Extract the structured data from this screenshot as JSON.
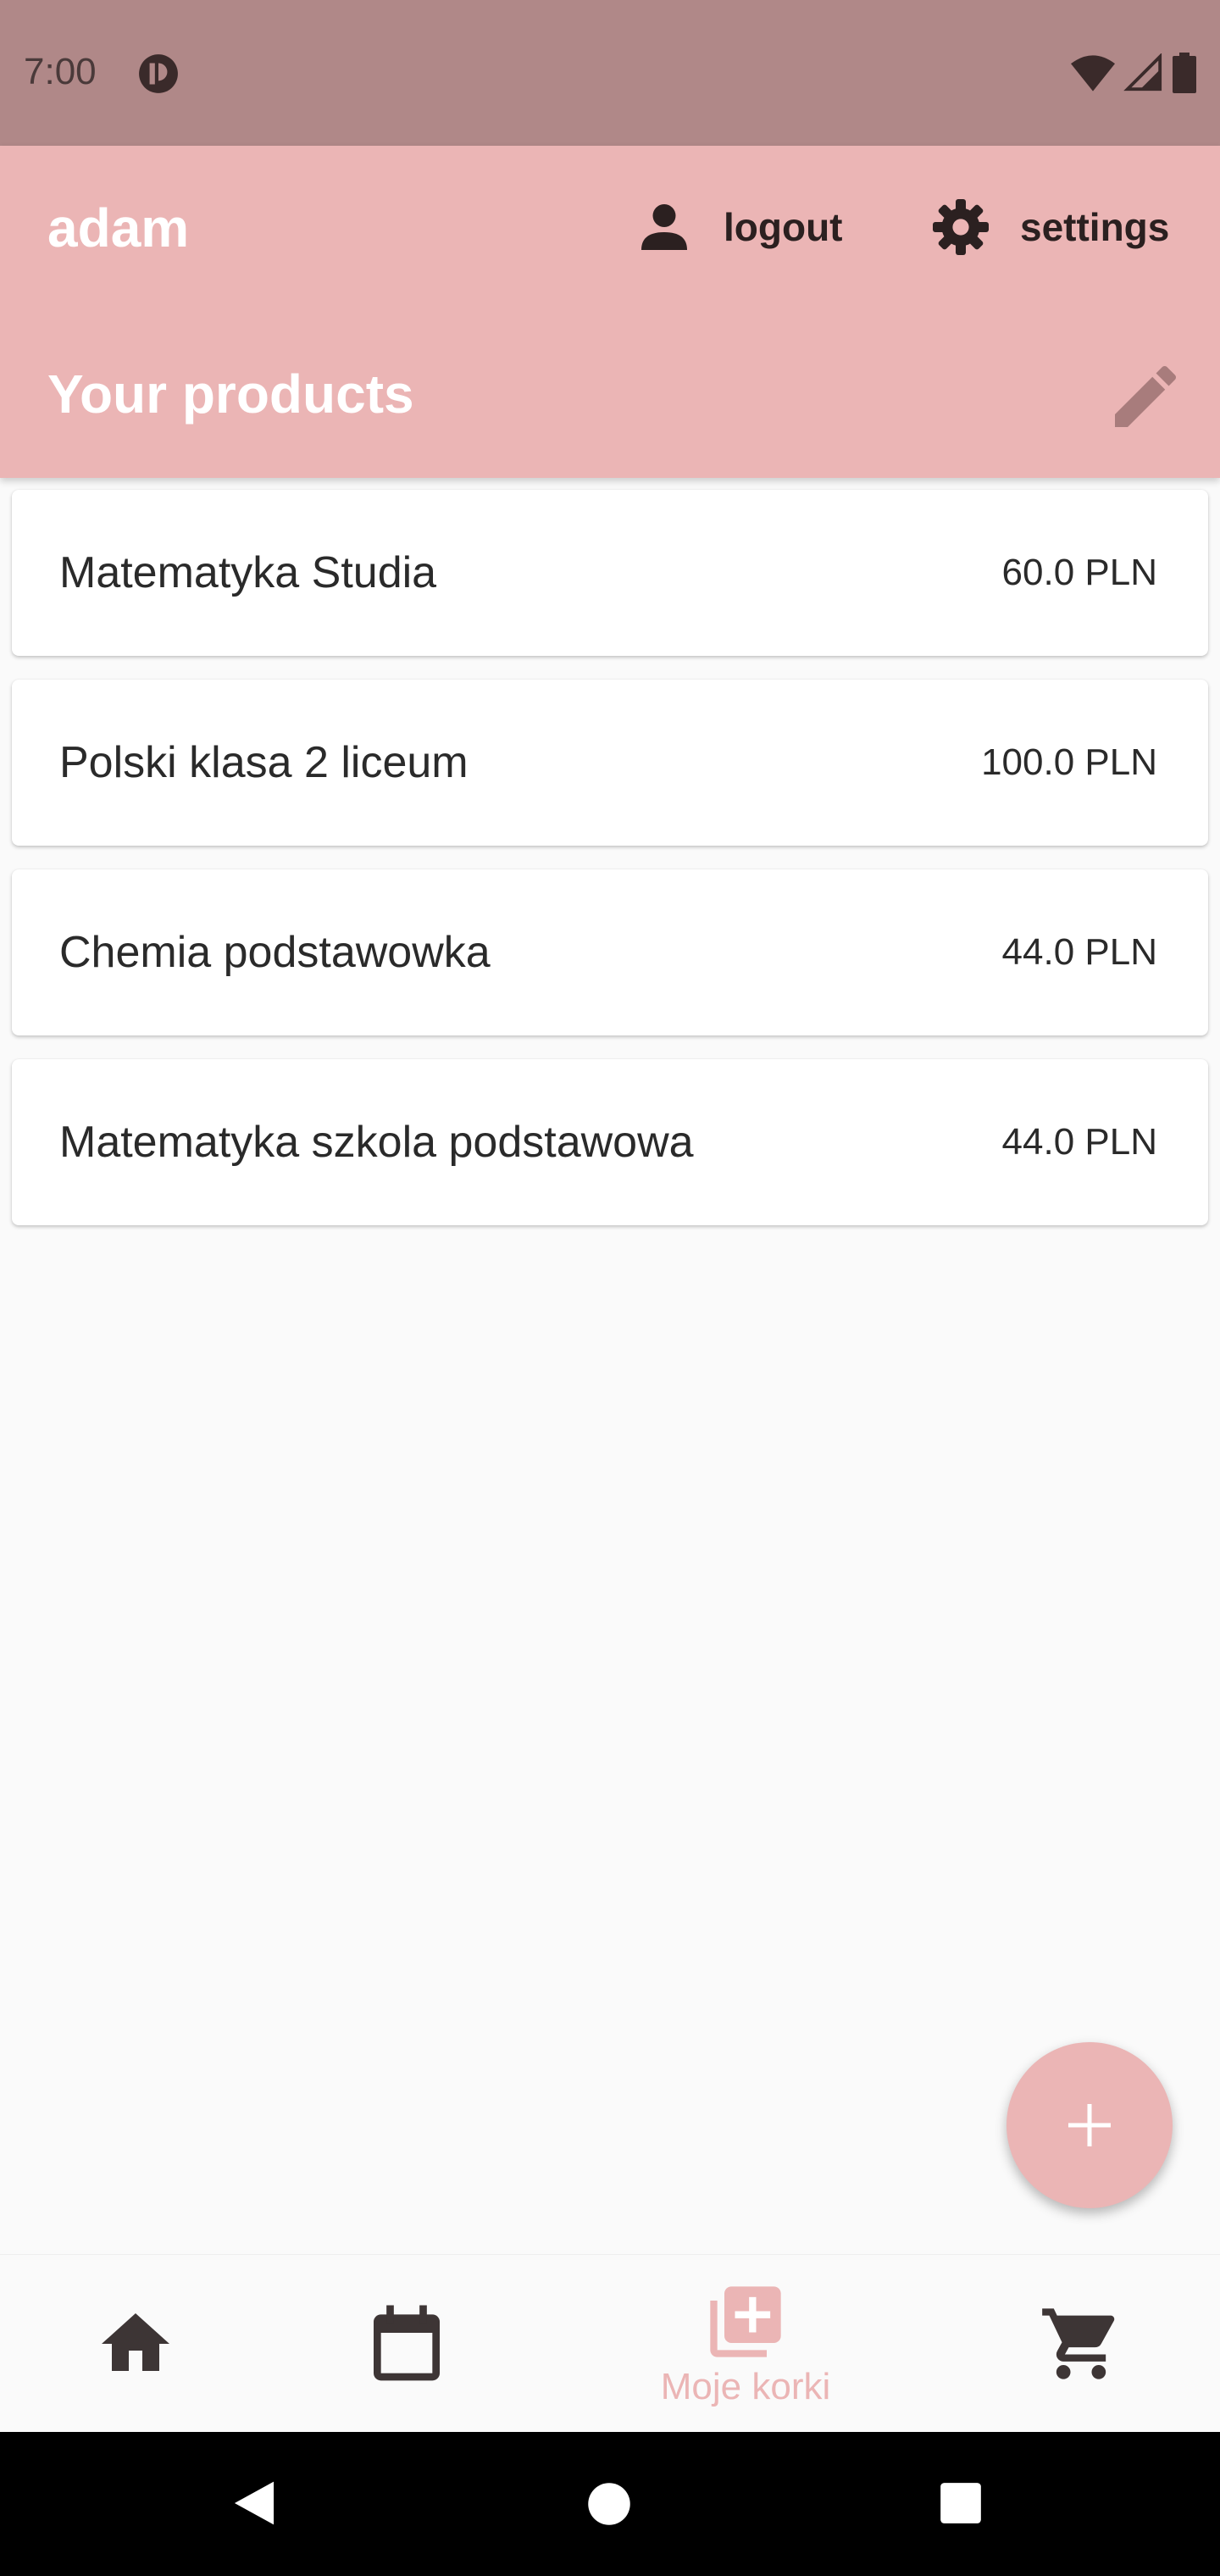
{
  "status_bar": {
    "time": "7:00",
    "icons": [
      "app-notification-icon",
      "wifi-icon",
      "signal-icon",
      "battery-icon"
    ]
  },
  "header": {
    "username": "adam",
    "logout_label": "logout",
    "settings_label": "settings",
    "title": "Your products",
    "icons": [
      "person-icon",
      "gear-icon",
      "edit-pencil-icon"
    ]
  },
  "products": [
    {
      "name": "Matematyka Studia",
      "price": "60.0 PLN"
    },
    {
      "name": "Polski klasa 2 liceum",
      "price": "100.0 PLN"
    },
    {
      "name": "Chemia podstawowka",
      "price": "44.0 PLN"
    },
    {
      "name": "Matematyka szkola podstawowa",
      "price": "44.0 PLN"
    }
  ],
  "fab": {
    "icon": "plus-icon"
  },
  "bottom_nav": {
    "items": [
      {
        "icon": "home-icon",
        "label": ""
      },
      {
        "icon": "calendar-icon",
        "label": ""
      },
      {
        "icon": "add-library-icon",
        "label": "Moje korki",
        "active": true
      },
      {
        "icon": "shopping-cart-icon",
        "label": ""
      }
    ]
  },
  "system_nav": {
    "icons": [
      "back-icon",
      "home-circle-icon",
      "recents-icon"
    ]
  },
  "colors": {
    "status_bar": "#b08888",
    "app_bar": "#ebb5b5",
    "accent": "#ebb5b5",
    "background": "#fafafa",
    "icon_dark": "#2b2020"
  }
}
